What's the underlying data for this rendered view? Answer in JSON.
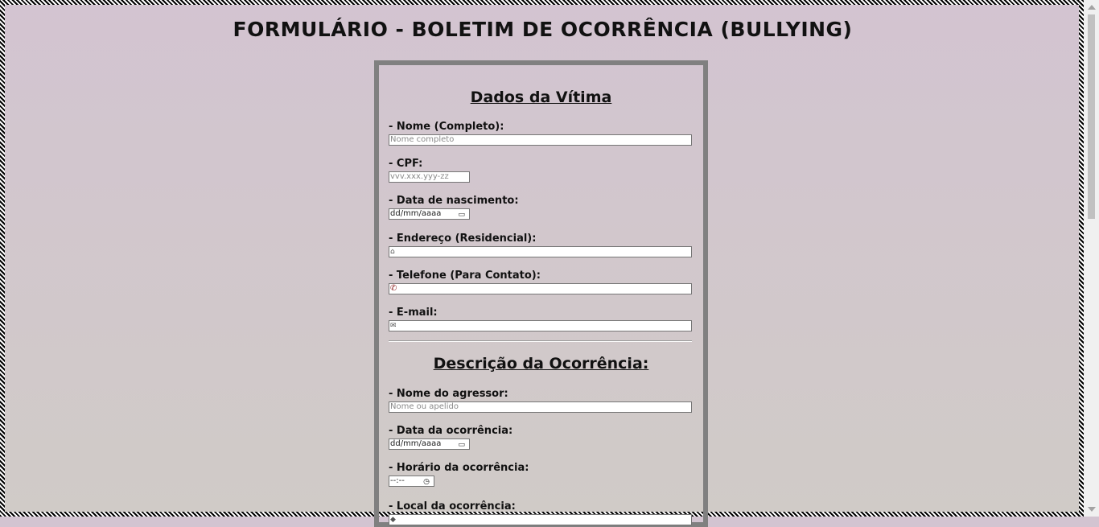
{
  "page": {
    "title": "FORMULÁRIO - BOLETIM DE OCORRÊNCIA (BULLYING)"
  },
  "victim": {
    "title": "Dados da Vítima",
    "name_label": "- Nome (Completo):",
    "name_placeholder": "Nome completo",
    "cpf_label": "- CPF:",
    "cpf_placeholder": "vvv.xxx.yyy-zz",
    "birth_label": "- Data de nascimento:",
    "birth_value": "dd/mm/aaaa",
    "address_label": "- Endereço (Residencial):",
    "address_icon": "home-icon",
    "phone_label": "- Telefone (Para Contato):",
    "phone_icon": "phone-icon",
    "email_label": "- E-mail:",
    "email_icon": "envelope-icon"
  },
  "incident": {
    "title": "Descrição da Ocorrência:",
    "aggressor_label": "- Nome do agressor:",
    "aggressor_placeholder": "Nome ou apelido",
    "date_label": "- Data da ocorrência:",
    "date_value": "dd/mm/aaaa",
    "time_label": "- Horário da ocorrência:",
    "time_value": "--:--",
    "location_label": "- Local da ocorrência:"
  },
  "colors": {
    "frame_border": "#808080",
    "phone_icon": "#8b1c1c"
  }
}
